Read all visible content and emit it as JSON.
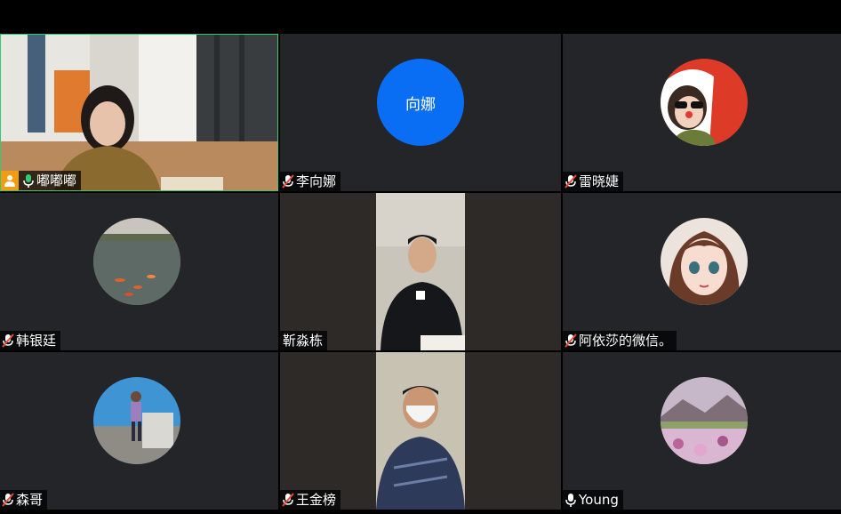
{
  "participants": [
    {
      "name": "嘟嘟嘟",
      "host": true,
      "mic": "on"
    },
    {
      "name": "李向娜",
      "avatar_text": "向娜",
      "mic": "muted"
    },
    {
      "name": "雷晓婕",
      "mic": "muted"
    },
    {
      "name": "韩银廷",
      "mic": "muted"
    },
    {
      "name": "靳淼栋",
      "mic": "none"
    },
    {
      "name": "阿依莎的微信。",
      "mic": "muted"
    },
    {
      "name": "森哥",
      "mic": "muted"
    },
    {
      "name": "王金榜",
      "mic": "muted"
    },
    {
      "name": "Young",
      "mic": "on"
    }
  ],
  "colors": {
    "tile_bg": "#232529",
    "active_border": "#2ecc71",
    "avatar_blue": "#0a6ef5",
    "host_badge": "#f39c12",
    "mic_on": "#ffffff",
    "mic_muted": "#e74c3c"
  }
}
